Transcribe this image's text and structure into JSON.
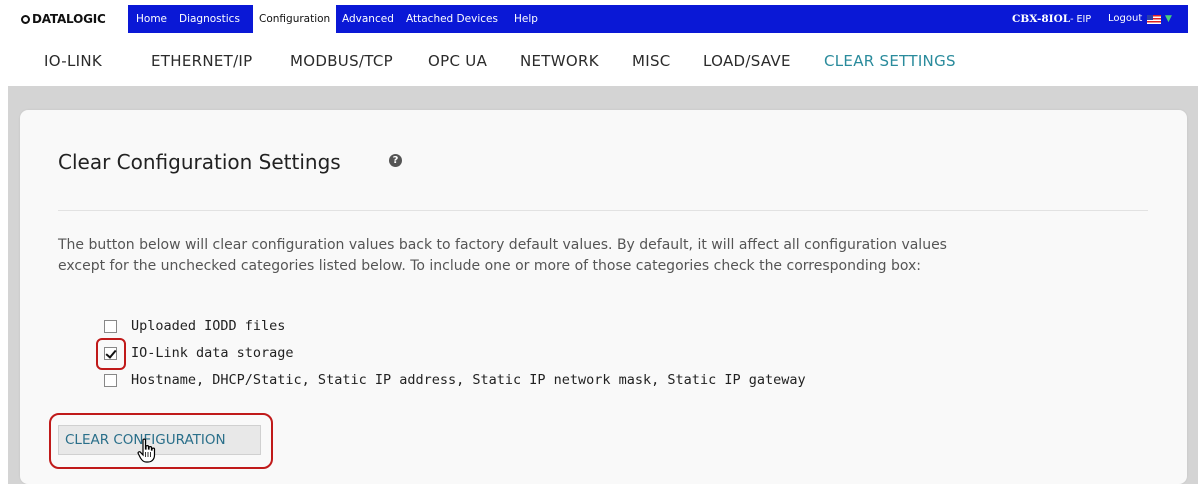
{
  "brand": {
    "logo": "DATALOGIC"
  },
  "nav": {
    "tabs": [
      {
        "label": "Home",
        "active": false
      },
      {
        "label": "Diagnostics",
        "active": false
      },
      {
        "label": "Configuration",
        "active": true
      },
      {
        "label": "Advanced",
        "active": false
      },
      {
        "label": "Attached Devices",
        "active": false
      },
      {
        "label": "Help",
        "active": false
      }
    ],
    "device_model": "CBX-8IOL",
    "device_suffix": "- EIP",
    "logout": "Logout",
    "language_icon": "us-flag-icon"
  },
  "subnav": {
    "tabs": [
      {
        "label": "IO-LINK",
        "active": false
      },
      {
        "label": "ETHERNET/IP",
        "active": false
      },
      {
        "label": "MODBUS/TCP",
        "active": false
      },
      {
        "label": "OPC UA",
        "active": false
      },
      {
        "label": "NETWORK",
        "active": false
      },
      {
        "label": "MISC",
        "active": false
      },
      {
        "label": "LOAD/SAVE",
        "active": false
      },
      {
        "label": "CLEAR SETTINGS",
        "active": true
      }
    ]
  },
  "panel": {
    "title": "Clear Configuration Settings",
    "help_icon": "question-circle-icon",
    "description_line1": "The button below will clear configuration values back to factory default values. By default, it will affect all configuration values",
    "description_line2": "except for the unchecked categories listed below. To include one or more of those categories check the corresponding box:",
    "options": [
      {
        "label": "Uploaded IODD files",
        "checked": false
      },
      {
        "label": "IO-Link data storage",
        "checked": true
      },
      {
        "label": "Hostname, DHCP/Static, Static IP address, Static IP network mask, Static IP gateway",
        "checked": false
      }
    ],
    "clear_button": "CLEAR CONFIGURATION"
  },
  "colors": {
    "nav_bg": "#0a18d6",
    "active_subtab": "#2a8b9c",
    "highlight": "#c01a1a",
    "backdrop": "#d4d4d4"
  }
}
